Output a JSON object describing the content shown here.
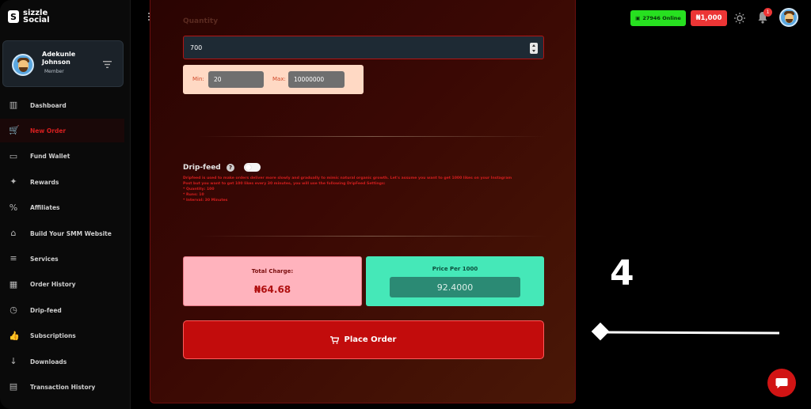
{
  "brand": {
    "mark": "S",
    "line1": "sizzle",
    "line2": "Social"
  },
  "profile": {
    "name": "Adekunle Johnson",
    "role": "Member"
  },
  "nav": [
    {
      "label": "Dashboard",
      "icon": "dashboard-icon",
      "glyph": "▥"
    },
    {
      "label": "New Order",
      "icon": "cart-icon",
      "glyph": "🛒",
      "active": true
    },
    {
      "label": "Fund Wallet",
      "icon": "wallet-icon",
      "glyph": "▭"
    },
    {
      "label": "Rewards",
      "icon": "gift-icon",
      "glyph": "✦"
    },
    {
      "label": "Affiliates",
      "icon": "percent-icon",
      "glyph": "%"
    },
    {
      "label": "Build Your SMM Website",
      "icon": "store-icon",
      "glyph": "⌂"
    },
    {
      "label": "Services",
      "icon": "list-icon",
      "glyph": "≡"
    },
    {
      "label": "Order History",
      "icon": "calendar-icon",
      "glyph": "▦"
    },
    {
      "label": "Drip-feed",
      "icon": "clock-icon",
      "glyph": "◷"
    },
    {
      "label": "Subscriptions",
      "icon": "thumbs-up-icon",
      "glyph": "👍"
    },
    {
      "label": "Downloads",
      "icon": "download-icon",
      "glyph": "↓"
    },
    {
      "label": "Transaction History",
      "icon": "file-icon",
      "glyph": "▤"
    }
  ],
  "topbar": {
    "online": "27946 Online",
    "balance": "₦1,000",
    "notifications": "1"
  },
  "order": {
    "quantity_label": "Quantity",
    "quantity_value": "700",
    "min_label": "Min:",
    "min_value": "20",
    "max_label": "Max:",
    "max_value": "10000000",
    "dripfeed_label": "Drip-feed",
    "dripfeed_help": "?",
    "dripfeed_desc": [
      "Dripfeed is used to make orders deliver more slowly and gradually to mimic natural organic growth. Let's assume you want to get 1000 likes on your Instagram",
      "Post but you want to get 100 likes every 30 minutes, you will use the following DripFeed Settings:",
      "* Quantity: 100",
      "* Runs: 10",
      "* Interval: 30 Minutes"
    ],
    "total_label": "Total Charge:",
    "total_value": "₦64.68",
    "price_label": "Price Per 1000",
    "price_value": "92.4000",
    "place_order": "Place Order"
  },
  "annotation": {
    "step": "4"
  },
  "colors": {
    "accent": "#c20c0c",
    "online": "#27e020",
    "balance": "#ec3535",
    "price": "#45e8b8",
    "total": "#ffb3bd"
  }
}
